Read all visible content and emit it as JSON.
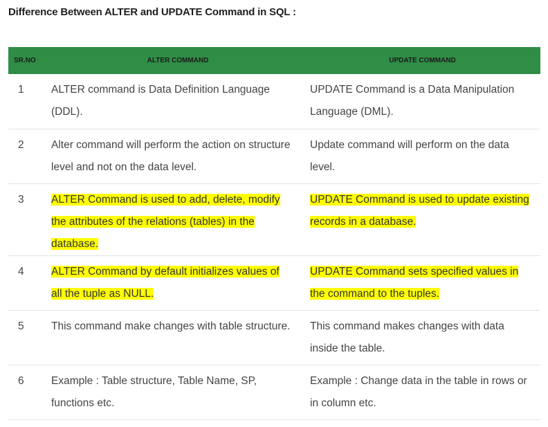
{
  "heading": "Difference Between ALTER and UPDATE Command in SQL :",
  "columns": [
    "SR.NO",
    "ALTER COMMAND",
    "UPDATE COMMAND"
  ],
  "colors": {
    "header_bg": "#2f8d46",
    "highlight": "#ffff00"
  },
  "rows": [
    {
      "no": "1",
      "alter": "ALTER command is Data Definition Language (DDL).",
      "update": "UPDATE Command is a Data Manipulation Language (DML).",
      "highlighted": false
    },
    {
      "no": "2",
      "alter": "Alter command will perform the action on structure level and not on the data level.",
      "update": "Update command will perform on the data level.",
      "highlighted": false
    },
    {
      "no": "3",
      "alter": "ALTER Command is used to add, delete, modify the attributes of the relations (tables) in the database.",
      "update": "UPDATE Command is used to update existing records in a database.",
      "highlighted": true
    },
    {
      "no": "4",
      "alter": "ALTER Command by default initializes values of all the tuple as NULL.",
      "update": "UPDATE Command sets specified values in the command to the tuples.",
      "highlighted": true
    },
    {
      "no": "5",
      "alter": "This command make changes with table structure.",
      "update": "This command makes changes with data inside the table.",
      "highlighted": false
    },
    {
      "no": "6",
      "alter": "Example : Table structure, Table Name, SP, functions etc.",
      "update": "Example : Change data in the table in rows or in column etc.",
      "highlighted": false
    }
  ]
}
